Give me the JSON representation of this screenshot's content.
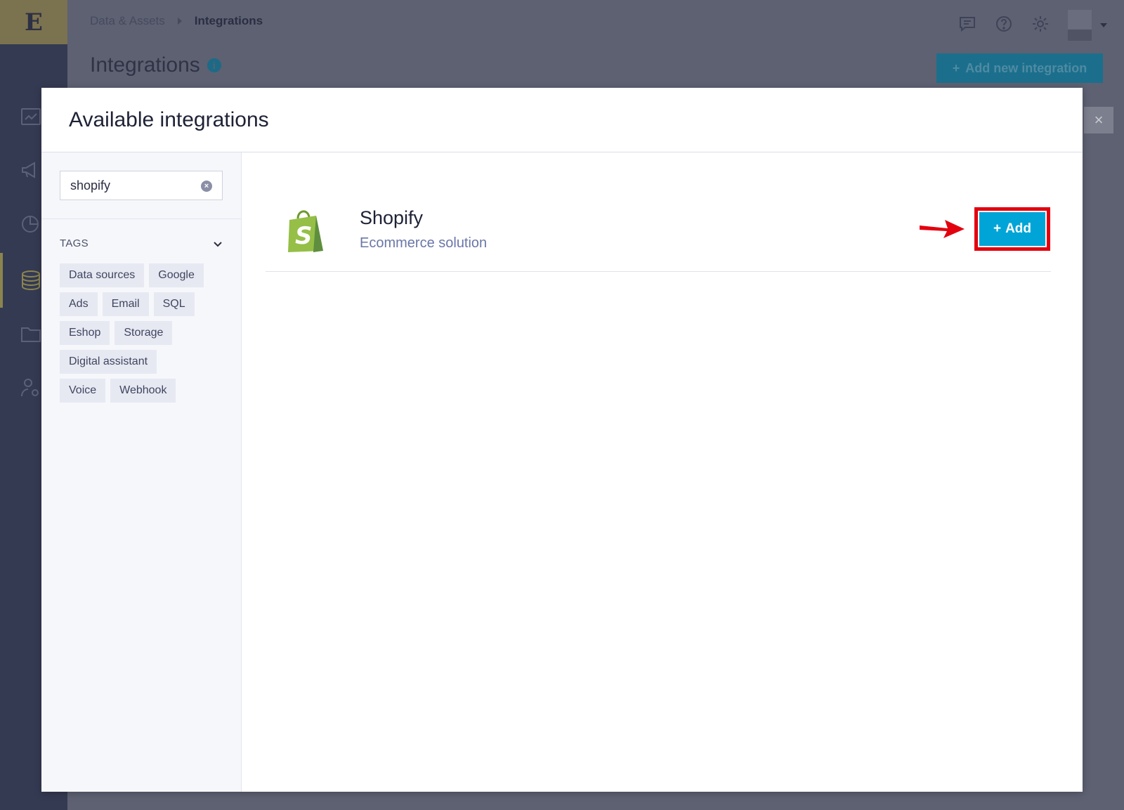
{
  "app": {
    "logo_text": "E",
    "breadcrumb": [
      "Data & Assets",
      "Integrations"
    ],
    "page_title": "Integrations",
    "info_icon_text": "i",
    "add_new_button": "Add new integration",
    "close_label": "×"
  },
  "modal": {
    "title": "Available integrations",
    "search": {
      "value": "shopify",
      "placeholder": ""
    },
    "tags_label": "TAGS",
    "tags": [
      "Data sources",
      "Google",
      "Ads",
      "Email",
      "SQL",
      "Eshop",
      "Storage",
      "Digital assistant",
      "Voice",
      "Webhook"
    ],
    "results": [
      {
        "name": "Shopify",
        "description": "Ecommerce solution",
        "add_label": "Add"
      }
    ]
  },
  "colors": {
    "add_button": "#00a4d6",
    "highlight": "#e3000f",
    "shopify_green": "#95bf47"
  }
}
